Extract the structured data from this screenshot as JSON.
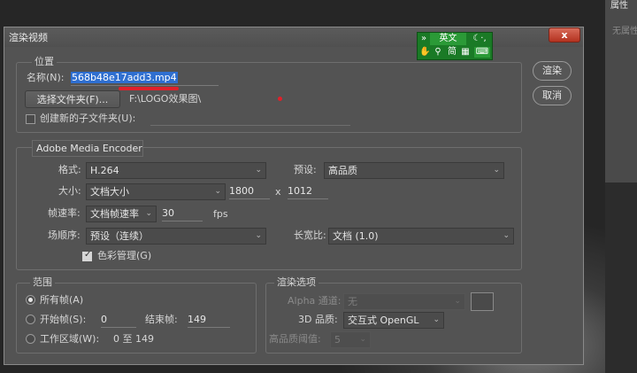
{
  "dialog": {
    "title": "渲染视频",
    "close_label": "x"
  },
  "location": {
    "legend": "位置",
    "name_label": "名称(N):",
    "name_value": "568b48e17add3.mp4",
    "choose_folder_label": "选择文件夹(F)...",
    "folder_path": "F:\\LOGO效果图\\",
    "create_subfolder_label": "创建新的子文件夹(U):",
    "create_subfolder_checked": false
  },
  "actions": {
    "render_label": "渲染",
    "cancel_label": "取消"
  },
  "encoder": {
    "selected": "Adobe Media Encoder",
    "format_label": "格式:",
    "format_value": "H.264",
    "preset_label": "预设:",
    "preset_value": "高品质",
    "size_label": "大小:",
    "size_value": "文档大小",
    "width": "1800",
    "times": "x",
    "height": "1012",
    "framerate_label": "帧速率:",
    "framerate_value": "文档帧速率",
    "fps_value": "30",
    "fps_unit": "fps",
    "field_order_label": "场顺序:",
    "field_order_value": "预设（连续）",
    "aspect_label": "长宽比:",
    "aspect_value": "文档 (1.0)",
    "color_mgmt_label": "色彩管理(G)",
    "color_mgmt_checked": true
  },
  "range": {
    "legend": "范围",
    "all_frames_label": "所有帧(A)",
    "start_frame_label": "开始帧(S):",
    "start_value": "0",
    "end_frame_label": "结束帧:",
    "end_value": "149",
    "work_area_label": "工作区域(W):",
    "work_area_value": "0 至 149",
    "selected": "all_frames"
  },
  "render_options": {
    "legend": "渲染选项",
    "alpha_label": "Alpha 通道:",
    "alpha_value": "无",
    "quality_3d_label": "3D 品质:",
    "quality_3d_value": "交互式 OpenGL",
    "hq_threshold_label": "高品质阈值:",
    "hq_threshold_value": "5"
  },
  "background_app": {
    "panel_tab": "属性",
    "panel_text": "无属性"
  },
  "ime": {
    "mode": "英文",
    "simplified": "简"
  }
}
